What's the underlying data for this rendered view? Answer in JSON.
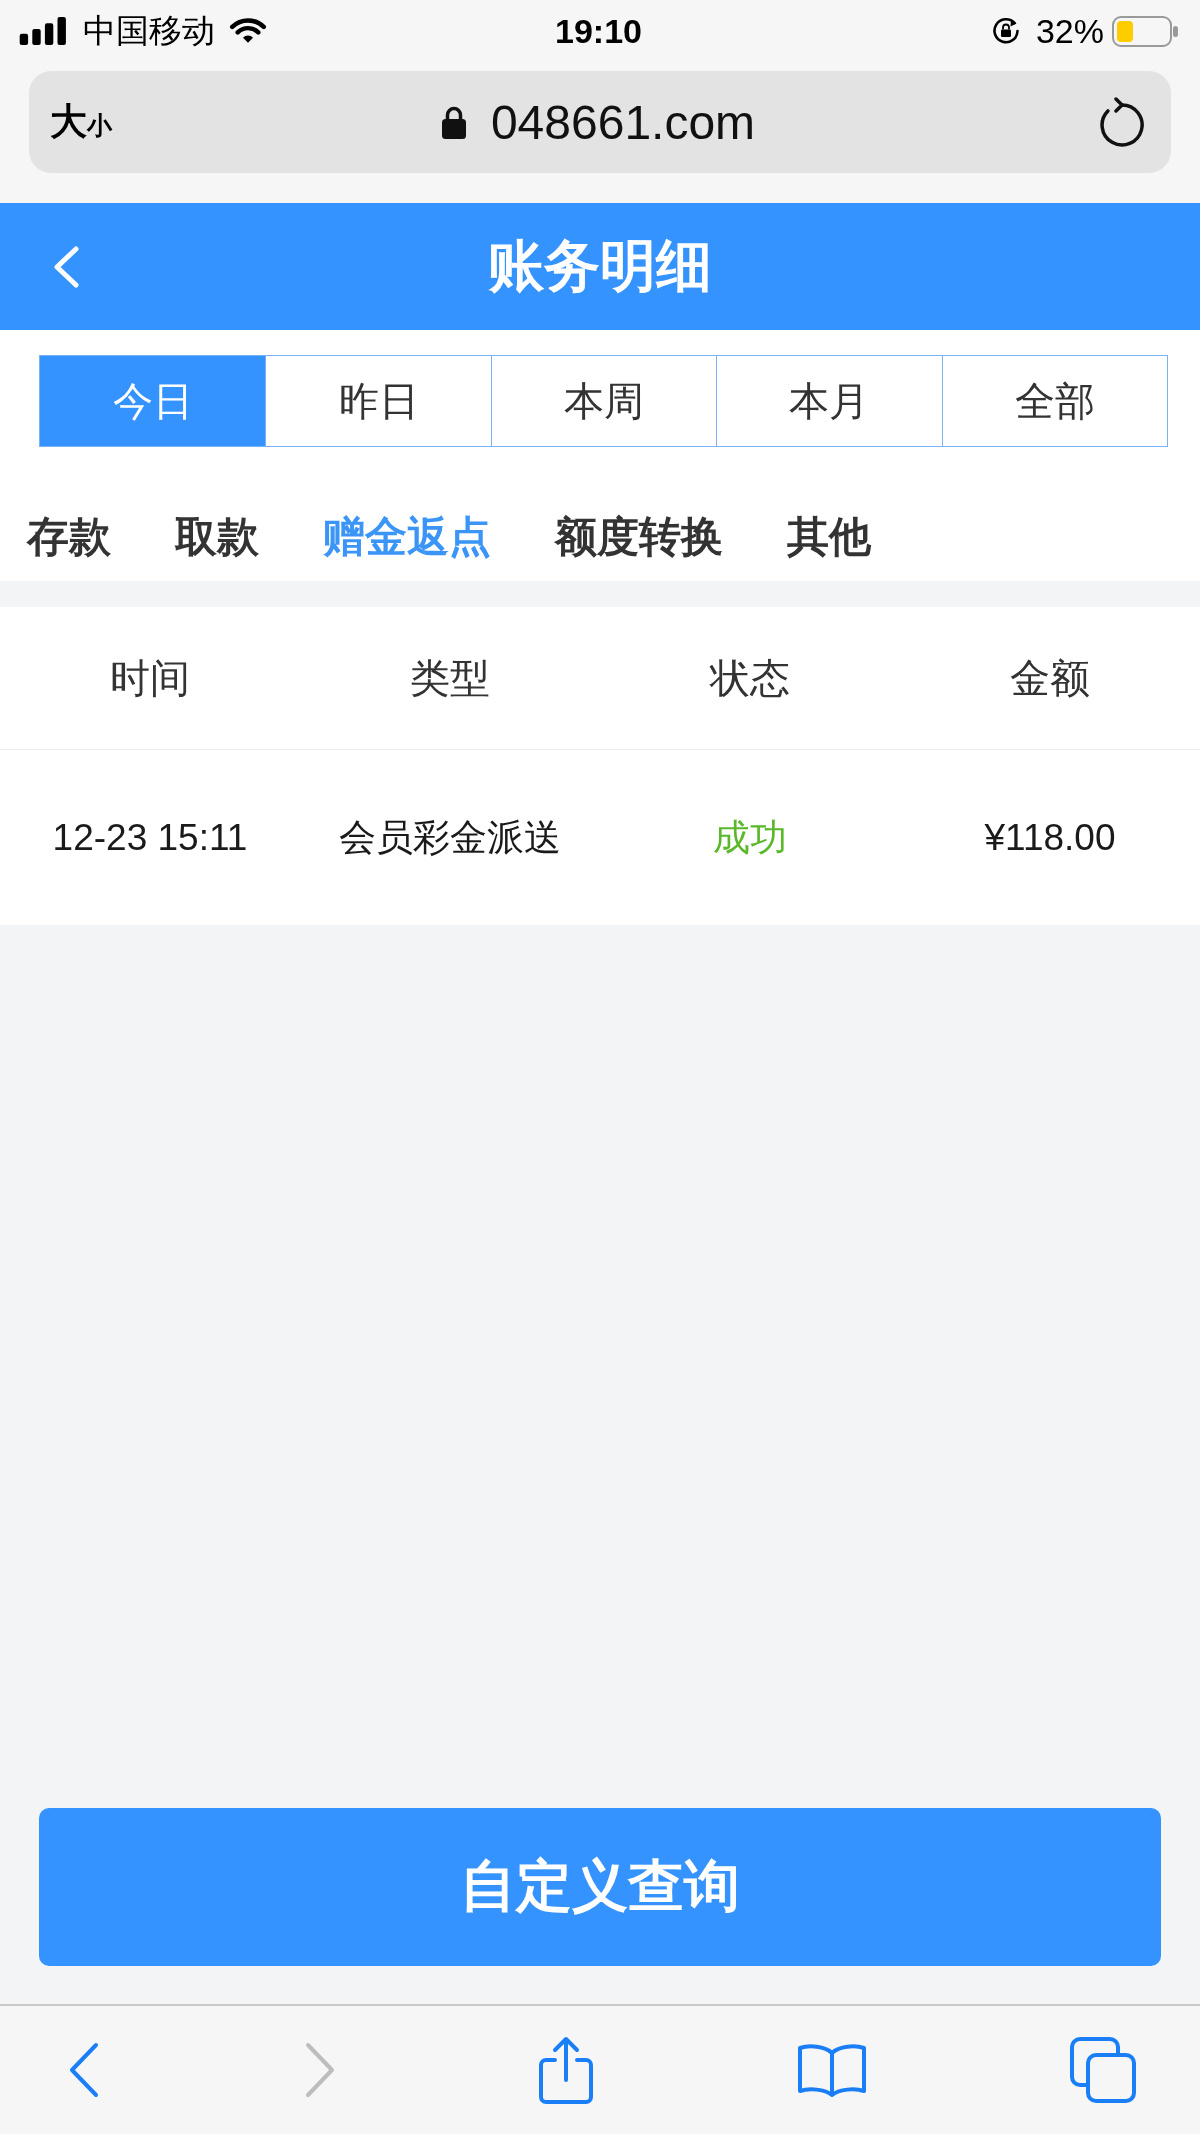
{
  "status_bar": {
    "carrier": "中国移动",
    "time": "19:10",
    "battery": "32%"
  },
  "address_bar": {
    "text_size_button": "大小",
    "url": "048661.com"
  },
  "header": {
    "title": "账务明细"
  },
  "period_tabs": [
    {
      "label": "今日",
      "selected": true
    },
    {
      "label": "昨日",
      "selected": false
    },
    {
      "label": "本周",
      "selected": false
    },
    {
      "label": "本月",
      "selected": false
    },
    {
      "label": "全部",
      "selected": false
    }
  ],
  "category_tabs": [
    {
      "label": "存款",
      "selected": false
    },
    {
      "label": "取款",
      "selected": false
    },
    {
      "label": "赠金返点",
      "selected": true
    },
    {
      "label": "额度转换",
      "selected": false
    },
    {
      "label": "其他",
      "selected": false
    }
  ],
  "table": {
    "columns": [
      "时间",
      "类型",
      "状态",
      "金额"
    ],
    "rows": [
      {
        "time": "12-23 15:11",
        "type": "会员彩金派送",
        "status": {
          "text": "成功",
          "kind": "success"
        },
        "amount": "¥118.00"
      }
    ]
  },
  "query_button": {
    "label": "自定义查询"
  },
  "toolbar": [
    {
      "kind": "back",
      "disabled": false
    },
    {
      "kind": "forward",
      "disabled": true
    },
    {
      "kind": "share",
      "disabled": false
    },
    {
      "kind": "bookmarks",
      "disabled": false
    },
    {
      "kind": "tabs",
      "disabled": false
    }
  ]
}
